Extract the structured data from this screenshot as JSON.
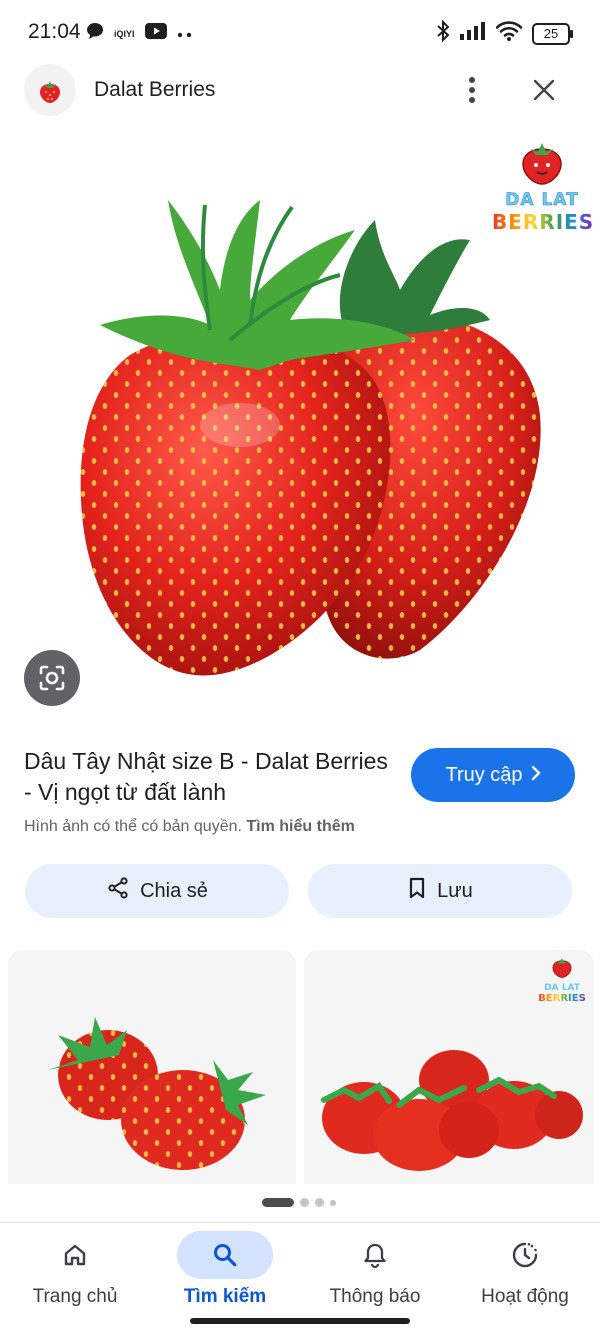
{
  "status": {
    "time": "21:04",
    "left_icons": [
      "message-icon",
      "iqiyi-icon",
      "youtube-icon",
      "more-notifications-icon"
    ],
    "iqiyi_text": "iQIYI",
    "right_icons": [
      "bluetooth-icon",
      "signal-icon",
      "wifi-icon",
      "battery-icon"
    ],
    "battery": "25"
  },
  "header": {
    "site_name": "Dalat Berries",
    "icons": [
      "site-logo-icon",
      "more-vert-icon",
      "close-icon"
    ]
  },
  "hero": {
    "brand_line1": "DA LAT",
    "brand_line2": "BERRIES",
    "lens_icon": "google-lens-icon"
  },
  "result": {
    "title": "Dâu Tây Nhật size B - Dalat Berries - Vị ngọt từ đất lành",
    "visit_label": "Truy cập",
    "copyright_text": "Hình ảnh có thể có bản quyền.",
    "learn_more": "Tìm hiểu thêm"
  },
  "actions": {
    "share_label": "Chia sẻ",
    "save_label": "Lưu"
  },
  "related": {
    "brand_line1": "DA LAT",
    "brand_line2": "BERRIES"
  },
  "nav": {
    "items": [
      {
        "label": "Trang chủ",
        "icon": "home-icon"
      },
      {
        "label": "Tìm kiếm",
        "icon": "search-icon"
      },
      {
        "label": "Thông báo",
        "icon": "bell-icon"
      },
      {
        "label": "Hoạt động",
        "icon": "activity-icon"
      }
    ],
    "active": "Tìm kiếm"
  },
  "colors": {
    "accent": "#1a73e8",
    "tonal_button": "#e8f0fe",
    "nav_active_pill": "#d3e3fd",
    "strawberry_red": "#e02424",
    "leaf_green": "#3aa84a"
  }
}
